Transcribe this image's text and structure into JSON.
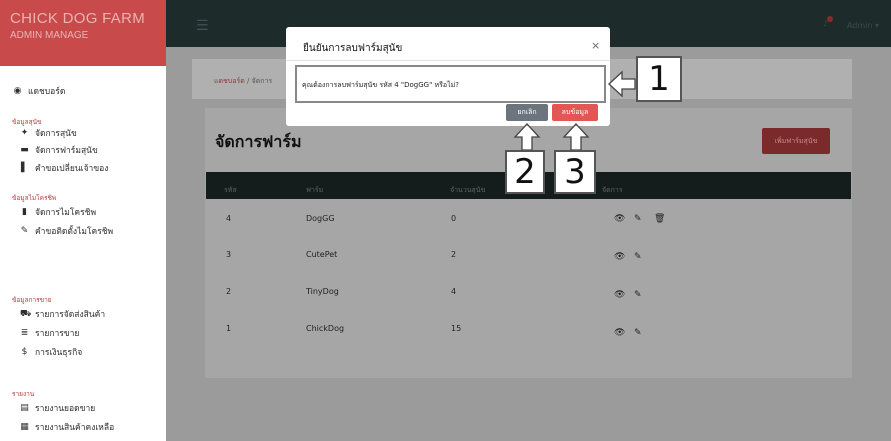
{
  "brand": {
    "title": "CHICK DOG FARM",
    "subtitle": "ADMIN MANAGE"
  },
  "sidebar": {
    "dashboard": "แดชบอร์ด",
    "section_dog": "ข้อมูลสุนัข",
    "manage_dog": "จัดการสุนัข",
    "manage_farm": "จัดการฟาร์มสุนัข",
    "transfer_owner": "คำขอเปลี่ยนเจ้าของ",
    "section_micro": "ข้อมูลไมโครชิพ",
    "manage_micro": "จัดการไมโครชิพ",
    "micro_request": "คำขอติดตั้งไมโครชิพ",
    "section_sales": "ข้อมูลการขาย",
    "shipping": "รายการจัดส่งสินค้า",
    "sales_list": "รายการขาย",
    "finance": "การเงินธุรกิจ",
    "section_report": "รายงาน",
    "sales_report": "รายงานยอดขาย",
    "stock_report": "รายงานสินค้าคงเหลือ"
  },
  "topbar": {
    "user": "Admin"
  },
  "breadcrumb": {
    "home": "แดชบอร์ด",
    "separator": "/",
    "current": "จัดการ"
  },
  "page": {
    "title": "จัดการฟาร์ม",
    "add_button": "เพิ่มฟาร์มสุนัข"
  },
  "table": {
    "headers": [
      "รหัส",
      "ฟาร์ม",
      "จำนวนสุนัข",
      "จัดการ"
    ],
    "rows": [
      {
        "id": "4",
        "farm": "DogGG",
        "count": "0"
      },
      {
        "id": "3",
        "farm": "CutePet",
        "count": "2"
      },
      {
        "id": "2",
        "farm": "TinyDog",
        "count": "4"
      },
      {
        "id": "1",
        "farm": "ChickDog",
        "count": "15"
      }
    ]
  },
  "modal": {
    "title": "ยืนยันการลบฟาร์มสุนัข",
    "close": "×",
    "message": "คุณต้องการลบฟาร์มสุนัข รหัส 4 \"DogGG\" หรือไม่?",
    "cancel": "ยกเลิก",
    "confirm": "ลบข้อมูล"
  },
  "callouts": [
    "1",
    "2",
    "3"
  ]
}
